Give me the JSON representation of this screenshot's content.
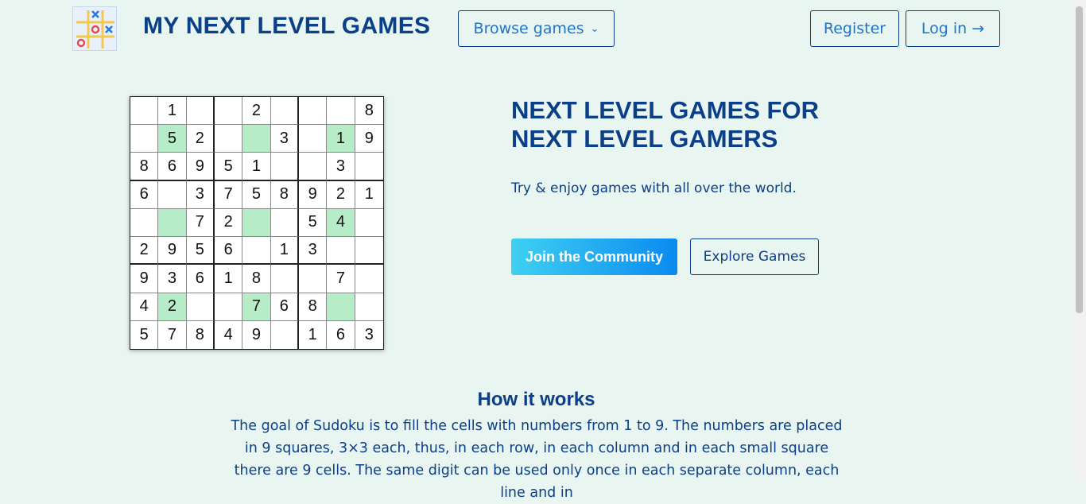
{
  "header": {
    "brand": "MY NEXT LEVEL GAMES",
    "browse_label": "Browse games",
    "browse_chevron": "⌄",
    "register_label": "Register",
    "login_label": "Log in →"
  },
  "sudoku": {
    "rows": [
      [
        "",
        "1",
        "",
        "",
        "2",
        "",
        "",
        "",
        "8"
      ],
      [
        "",
        "5",
        "2",
        "",
        "",
        "3",
        "",
        "1",
        "9"
      ],
      [
        "8",
        "6",
        "9",
        "5",
        "1",
        "",
        "",
        "3",
        ""
      ],
      [
        "6",
        "",
        "3",
        "7",
        "5",
        "8",
        "9",
        "2",
        "1"
      ],
      [
        "",
        "",
        "7",
        "2",
        "",
        "",
        "5",
        "4",
        ""
      ],
      [
        "2",
        "9",
        "5",
        "6",
        "",
        "1",
        "3",
        "",
        ""
      ],
      [
        "9",
        "3",
        "6",
        "1",
        "8",
        "",
        "",
        "7",
        ""
      ],
      [
        "4",
        "2",
        "",
        "",
        "7",
        "6",
        "8",
        "",
        ""
      ],
      [
        "5",
        "7",
        "8",
        "4",
        "9",
        "",
        "1",
        "6",
        "3"
      ]
    ],
    "highlighted": [
      [
        1,
        1
      ],
      [
        1,
        4
      ],
      [
        1,
        7
      ],
      [
        4,
        1
      ],
      [
        4,
        4
      ],
      [
        4,
        7
      ],
      [
        7,
        1
      ],
      [
        7,
        4
      ],
      [
        7,
        7
      ]
    ],
    "highlight_color": "#b7ecc8"
  },
  "hero": {
    "title": "NEXT LEVEL GAMES FOR NEXT LEVEL GAMERS",
    "subtitle": "Try & enjoy games with all over the world.",
    "join_label": "Join the Community",
    "explore_label": "Explore Games"
  },
  "how": {
    "title": "How it works",
    "text": "The goal of Sudoku is to fill the cells with numbers from 1 to 9. The numbers are placed in 9 squares, 3×3 each, thus, in each row, in each column and in each small square there are 9 cells. The same digit can be used only once in each separate column, each line and in"
  },
  "colors": {
    "background": "#e9f5f1",
    "primary_text": "#0b3f87",
    "link_blue": "#1f74c8",
    "join_gradient_start": "#3fd0f2",
    "join_gradient_end": "#0b8af0"
  },
  "icons": {
    "logo": "tic-tac-toe-logo-icon"
  }
}
